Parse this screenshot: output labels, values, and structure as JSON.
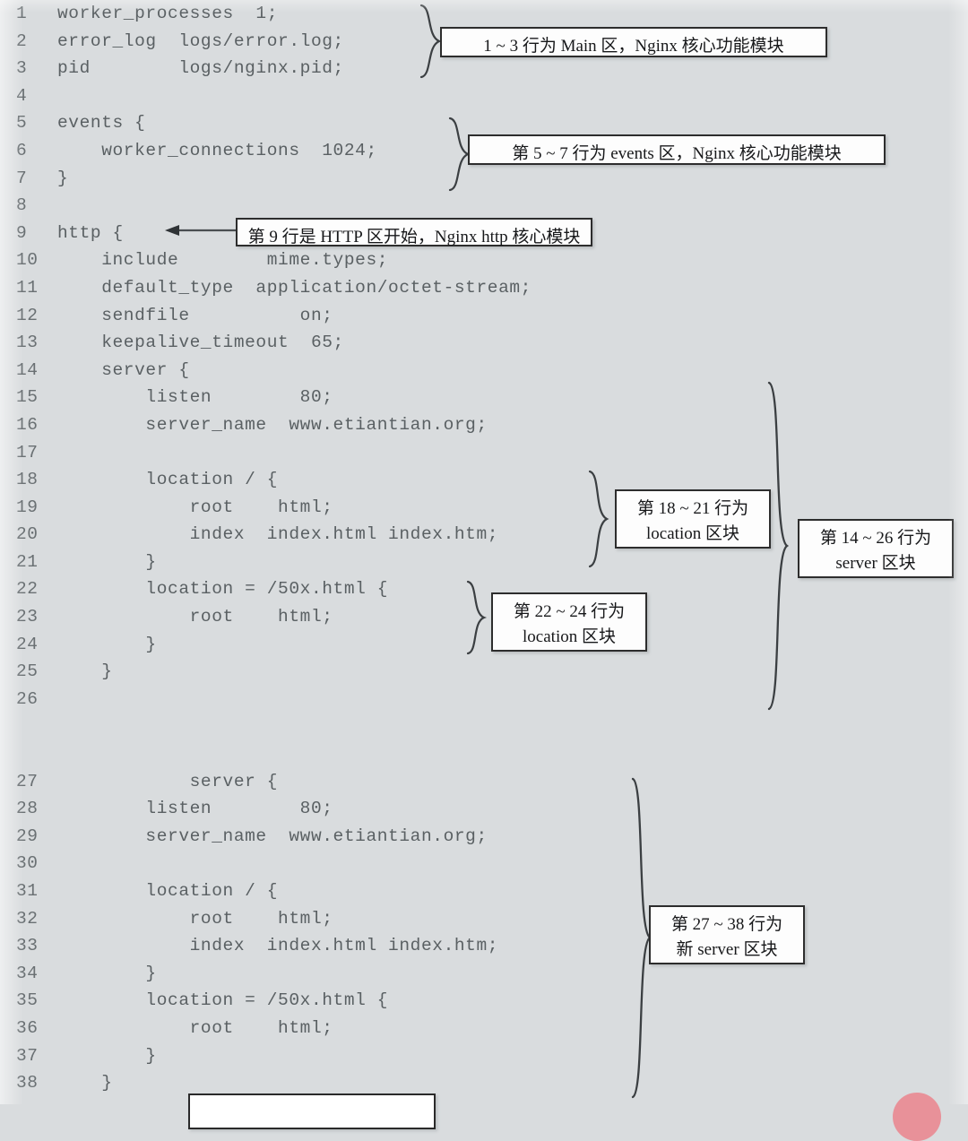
{
  "figure": {
    "kind": "annotated-code-listing",
    "language": "nginx-config",
    "background_color": "#d9dcde",
    "code_color": "#5a6063",
    "callout_border_color": "#2d2d2d",
    "callout_fill_color": "#fdfdfd"
  },
  "code": {
    "lines": [
      {
        "n": "1",
        "text": "worker_processes  1;",
        "indent": 0
      },
      {
        "n": "2",
        "text": "error_log  logs/error.log;",
        "indent": 0
      },
      {
        "n": "3",
        "text": "pid        logs/nginx.pid;",
        "indent": 0
      },
      {
        "n": "4",
        "text": "",
        "indent": 0
      },
      {
        "n": "5",
        "text": "events {",
        "indent": 0
      },
      {
        "n": "6",
        "text": "    worker_connections  1024;",
        "indent": 0
      },
      {
        "n": "7",
        "text": "}",
        "indent": 0
      },
      {
        "n": "8",
        "text": "",
        "indent": 0
      },
      {
        "n": "9",
        "text": "http {",
        "indent": 0
      },
      {
        "n": "10",
        "text": "    include        mime.types;",
        "indent": 0
      },
      {
        "n": "11",
        "text": "    default_type  application/octet-stream;",
        "indent": 0
      },
      {
        "n": "12",
        "text": "    sendfile          on;",
        "indent": 0
      },
      {
        "n": "13",
        "text": "    keepalive_timeout  65;",
        "indent": 0
      },
      {
        "n": "14",
        "text": "    server {",
        "indent": 0
      },
      {
        "n": "15",
        "text": "        listen        80;",
        "indent": 0
      },
      {
        "n": "16",
        "text": "        server_name  www.etiantian.org;",
        "indent": 0
      },
      {
        "n": "17",
        "text": "",
        "indent": 0
      },
      {
        "n": "18",
        "text": "        location / {",
        "indent": 0
      },
      {
        "n": "19",
        "text": "            root    html;",
        "indent": 0
      },
      {
        "n": "20",
        "text": "            index  index.html index.htm;",
        "indent": 0
      },
      {
        "n": "21",
        "text": "        }",
        "indent": 0
      },
      {
        "n": "22",
        "text": "        location = /50x.html {",
        "indent": 0
      },
      {
        "n": "23",
        "text": "            root    html;",
        "indent": 0
      },
      {
        "n": "24",
        "text": "        }",
        "indent": 0
      },
      {
        "n": "25",
        "text": "    }",
        "indent": 0
      },
      {
        "n": "26",
        "text": "",
        "indent": 0
      },
      {
        "n": "",
        "text": "",
        "indent": 0
      },
      {
        "n": "",
        "text": "",
        "indent": 0
      },
      {
        "n": "27",
        "text": "            server {",
        "indent": 0
      },
      {
        "n": "28",
        "text": "        listen        80;",
        "indent": 0
      },
      {
        "n": "29",
        "text": "        server_name  www.etiantian.org;",
        "indent": 0
      },
      {
        "n": "30",
        "text": "",
        "indent": 0
      },
      {
        "n": "31",
        "text": "        location / {",
        "indent": 0
      },
      {
        "n": "32",
        "text": "            root    html;",
        "indent": 0
      },
      {
        "n": "33",
        "text": "            index  index.html index.htm;",
        "indent": 0
      },
      {
        "n": "34",
        "text": "        }",
        "indent": 0
      },
      {
        "n": "35",
        "text": "        location = /50x.html {",
        "indent": 0
      },
      {
        "n": "36",
        "text": "            root    html;",
        "indent": 0
      },
      {
        "n": "37",
        "text": "        }",
        "indent": 0
      },
      {
        "n": "38",
        "text": "    }",
        "indent": 0
      }
    ]
  },
  "annotations": {
    "main_block": {
      "text": "1 ~ 3 行为 Main 区，Nginx 核心功能模块",
      "range": "1 ~ 3"
    },
    "events_block": {
      "text": "第 5 ~ 7 行为 events 区，Nginx 核心功能模块",
      "range": "5 ~ 7"
    },
    "http_block": {
      "text": "第 9 行是 HTTP 区开始，Nginx http 核心模块",
      "range": "9"
    },
    "location_18_21": {
      "line1": "第 18 ~ 21 行为",
      "line2": "location 区块",
      "range": "18 ~ 21"
    },
    "location_22_24": {
      "line1": "第 22 ~ 24 行为",
      "line2": "location 区块",
      "range": "22 ~ 24"
    },
    "server_14_26": {
      "line1": "第 14 ~ 26 行为",
      "line2": "server 区块",
      "range": "14 ~ 26"
    },
    "server_27_38": {
      "line1": "第 27 ~ 38 行为",
      "line2": "新 server 区块",
      "range": "27 ~ 38"
    }
  }
}
